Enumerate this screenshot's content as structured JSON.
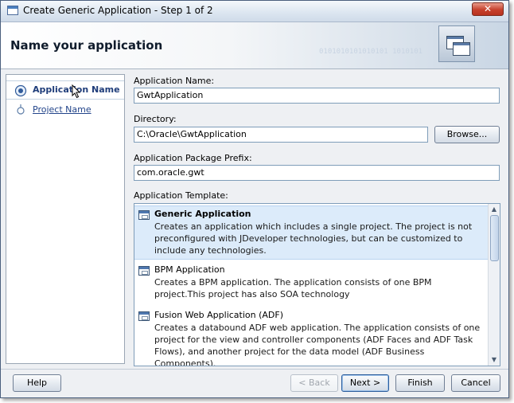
{
  "window": {
    "title": "Create Generic Application - Step 1 of 2",
    "close_glyph": "✕"
  },
  "header": {
    "title": "Name your application",
    "binary_watermark": "0101010101010101 1010101"
  },
  "sidebar": {
    "items": [
      {
        "label": "Application Name",
        "selected": true
      },
      {
        "label": "Project Name",
        "selected": false
      }
    ]
  },
  "form": {
    "app_name": {
      "label": "Application Name:",
      "value": "GwtApplication"
    },
    "directory": {
      "label": "Directory:",
      "value": "C:\\Oracle\\GwtApplication",
      "browse_label": "Browse..."
    },
    "package_prefix": {
      "label": "Application Package Prefix:",
      "value": "com.oracle.gwt"
    },
    "template": {
      "label": "Application Template:",
      "items": [
        {
          "name": "Generic Application",
          "selected": true,
          "description": "Creates an application which includes a single project. The project is not preconfigured with JDeveloper technologies, but can be customized to include any technologies."
        },
        {
          "name": "BPM Application",
          "selected": false,
          "description": "Creates a BPM application. The application consists of one BPM project.This project has also SOA technology"
        },
        {
          "name": "Fusion Web Application (ADF)",
          "selected": false,
          "description": "Creates a databound ADF web application. The application consists of one project for the view and controller components (ADF Faces and ADF Task Flows), and another project for the data model (ADF Business Components)."
        }
      ]
    }
  },
  "footer": {
    "help": "Help",
    "back": "< Back",
    "next": "Next >",
    "finish": "Finish",
    "cancel": "Cancel"
  },
  "colors": {
    "accent": "#1f3d7a",
    "selection": "#dcebfa",
    "close": "#c6412c"
  }
}
